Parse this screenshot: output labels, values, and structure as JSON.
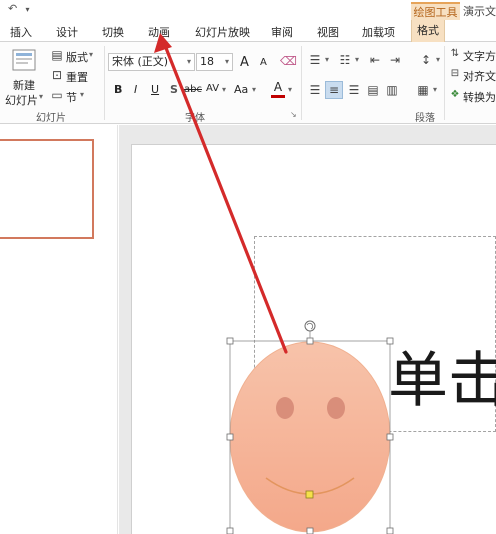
{
  "title_bar": {
    "quick_access_icons": [
      "undo-icon",
      "customize-qat-icon"
    ],
    "contextual_group": "绘图工具",
    "document_title": "演示文"
  },
  "tabs": [
    {
      "label": "插入"
    },
    {
      "label": "设计"
    },
    {
      "label": "切换"
    },
    {
      "label": "动画"
    },
    {
      "label": "幻灯片放映"
    },
    {
      "label": "审阅"
    },
    {
      "label": "视图"
    },
    {
      "label": "加载项"
    },
    {
      "label": "格式"
    }
  ],
  "ribbon": {
    "slides_group": {
      "label": "幻灯片",
      "new_slide": "新建",
      "new_slide_sub": "幻灯片",
      "layout": "版式",
      "reset": "重置",
      "section": "节"
    },
    "font_group": {
      "label": "字体",
      "font_name": "宋体 (正文)",
      "font_size": "18",
      "grow_font": "A",
      "shrink_font": "A",
      "bold": "B",
      "italic": "I",
      "underline": "U",
      "shadow": "S",
      "strikethrough": "abc",
      "char_spacing": "AV",
      "change_case": "Aa",
      "font_color": "A",
      "font_color_hex": "#c00000"
    },
    "paragraph_group": {
      "label": "段落",
      "text_direction": "文字方",
      "align_text": "对齐文",
      "convert_to_smartart": "转换为"
    }
  },
  "slide": {
    "placeholder_text": "单击"
  },
  "colors": {
    "smiley_fill": "#f5b59b",
    "smiley_eye": "#d98e7a",
    "smiley_mouth": "#e3955e",
    "annotation_arrow": "#d42a2a",
    "thumbnail_border": "#d2795d",
    "contextual_tab_bg": "#f7e0c2"
  }
}
